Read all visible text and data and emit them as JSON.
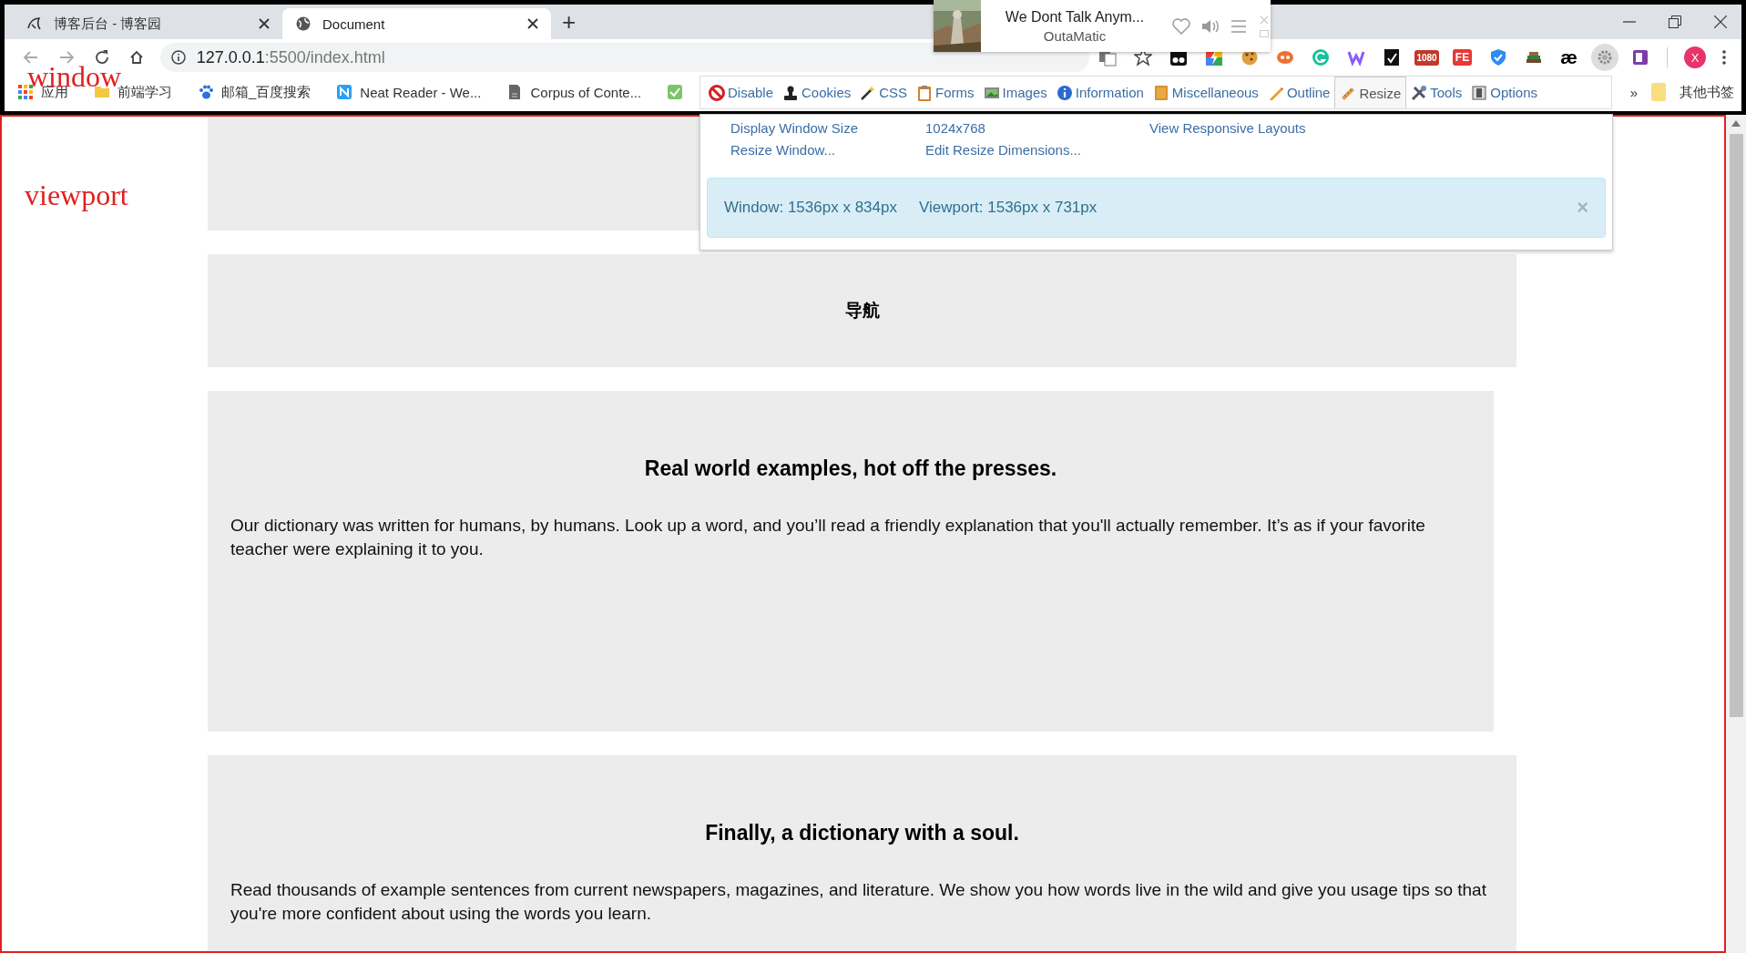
{
  "tabs": [
    {
      "title": "博客后台 - 博客园",
      "selected": false
    },
    {
      "title": "Document",
      "selected": true
    }
  ],
  "new_tab": "+",
  "media_popup": {
    "title": "We Dont Talk Anym...",
    "artist": "OutaMatic"
  },
  "address_bar": {
    "host": "127.0.0.1",
    "path": ":5500/index.html"
  },
  "extensions": [
    {
      "label": "1080"
    },
    {
      "label": "FE"
    },
    {
      "label": "æ"
    }
  ],
  "profile": {
    "initial": "X"
  },
  "bookmarks": [
    {
      "kind": "apps",
      "label": "应用"
    },
    {
      "kind": "folder",
      "label": "前端学习"
    },
    {
      "kind": "paw",
      "label": "邮箱_百度搜索"
    },
    {
      "kind": "letter",
      "label": "Neat Reader - We..."
    },
    {
      "kind": "document",
      "label": "Corpus of Conte..."
    },
    {
      "kind": "check"
    }
  ],
  "bookmarks_overflow": "»",
  "other_bookmarks": "其他书签",
  "annotations": [
    {
      "text": "window"
    },
    {
      "text": "viewport"
    }
  ],
  "webdev_toolbar": [
    {
      "label": "Disable",
      "selected": false
    },
    {
      "label": "Cookies",
      "selected": false
    },
    {
      "label": "CSS",
      "selected": false
    },
    {
      "label": "Forms",
      "selected": false
    },
    {
      "label": "Images",
      "selected": false
    },
    {
      "label": "Information",
      "selected": false
    },
    {
      "label": "Miscellaneous",
      "selected": false
    },
    {
      "label": "Outline",
      "selected": false
    },
    {
      "label": "Resize",
      "selected": true
    },
    {
      "label": "Tools",
      "selected": false
    },
    {
      "label": "Options",
      "selected": false
    }
  ],
  "resize_menu": {
    "links": [
      "Display Window Size",
      "1024x768",
      "View Responsive Layouts",
      "Resize Window...",
      "Edit Resize Dimensions..."
    ],
    "alert": {
      "window": "Window: 1536px x 834px",
      "viewport": "Viewport: 1536px x 731px",
      "close": "×"
    }
  },
  "page": {
    "sections": [
      {
        "kind": "blank"
      },
      {
        "kind": "nav",
        "heading": "导航"
      },
      {
        "kind": "article",
        "heading": "Real world examples, hot off the presses.",
        "text": "Our dictionary was written for humans, by humans. Look up a word, and you’ll read a friendly explanation that you'll actually remember. It’s as if your favorite teacher were explaining it to you."
      },
      {
        "kind": "article",
        "heading": "Finally, a dictionary with a soul.",
        "text": "Read thousands of example sentences from current newspapers, magazines, and literature. We show you how words live in the wild and give you usage tips so that you're more confident about using the words you learn."
      }
    ]
  }
}
